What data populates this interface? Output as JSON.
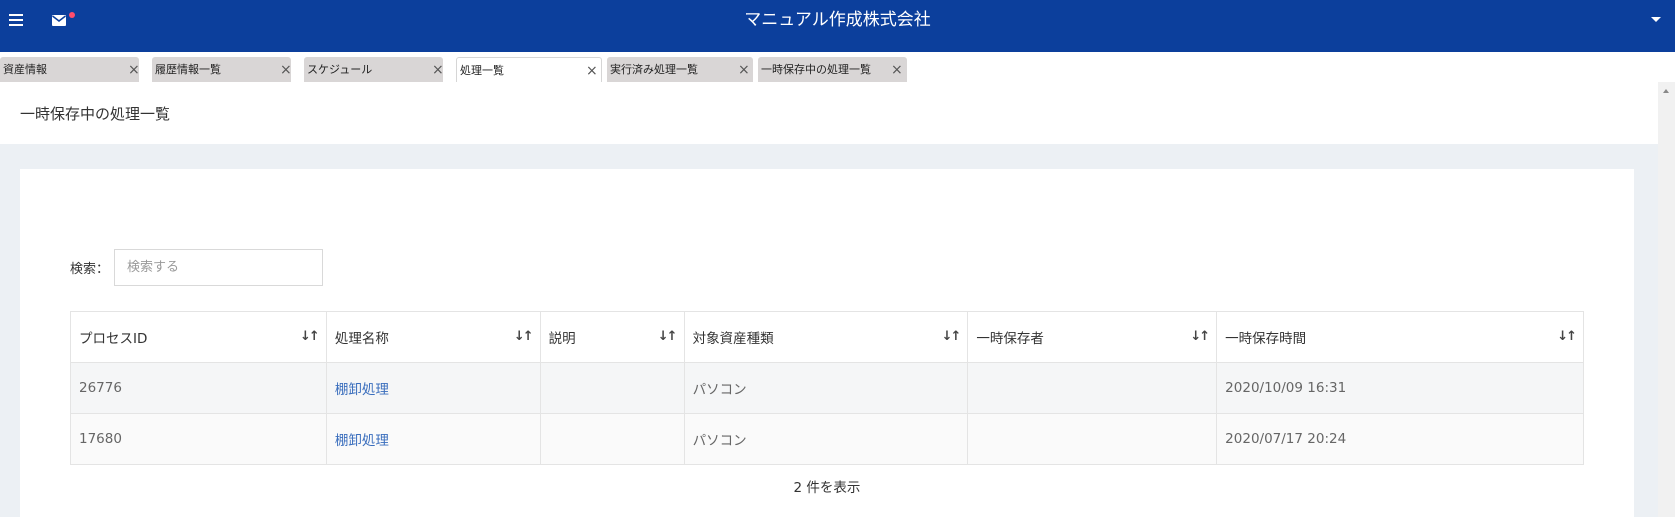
{
  "header": {
    "title": "マニュアル作成株式会社",
    "menu_icon": "hamburger-icon",
    "mail_icon": "mail-icon",
    "notification_color": "#ff4d6d",
    "bar_color": "#0c3f9c"
  },
  "tabs": [
    {
      "label": "資産情報",
      "active": false
    },
    {
      "label": "履歴情報一覧",
      "active": false
    },
    {
      "label": "スケジュール",
      "active": false
    },
    {
      "label": "処理一覧",
      "active": true
    },
    {
      "label": "実行済み処理一覧",
      "active": false
    },
    {
      "label": "一時保存中の処理一覧",
      "active": false
    }
  ],
  "page": {
    "title": "一時保存中の処理一覧"
  },
  "search": {
    "label": "検索：",
    "placeholder": "検索する",
    "value": ""
  },
  "table": {
    "columns": [
      "プロセスID",
      "処理名称",
      "説明",
      "対象資産種類",
      "一時保存者",
      "一時保存時間"
    ],
    "rows": [
      [
        "26776",
        "棚卸処理",
        "",
        "パソコン",
        "",
        "2020/10/09 16:31"
      ],
      [
        "17680",
        "棚卸処理",
        "",
        "パソコン",
        "",
        "2020/07/17 20:24"
      ]
    ],
    "info": "2 件を表示"
  },
  "icons": {
    "sort": "↓↑",
    "close": "×"
  }
}
